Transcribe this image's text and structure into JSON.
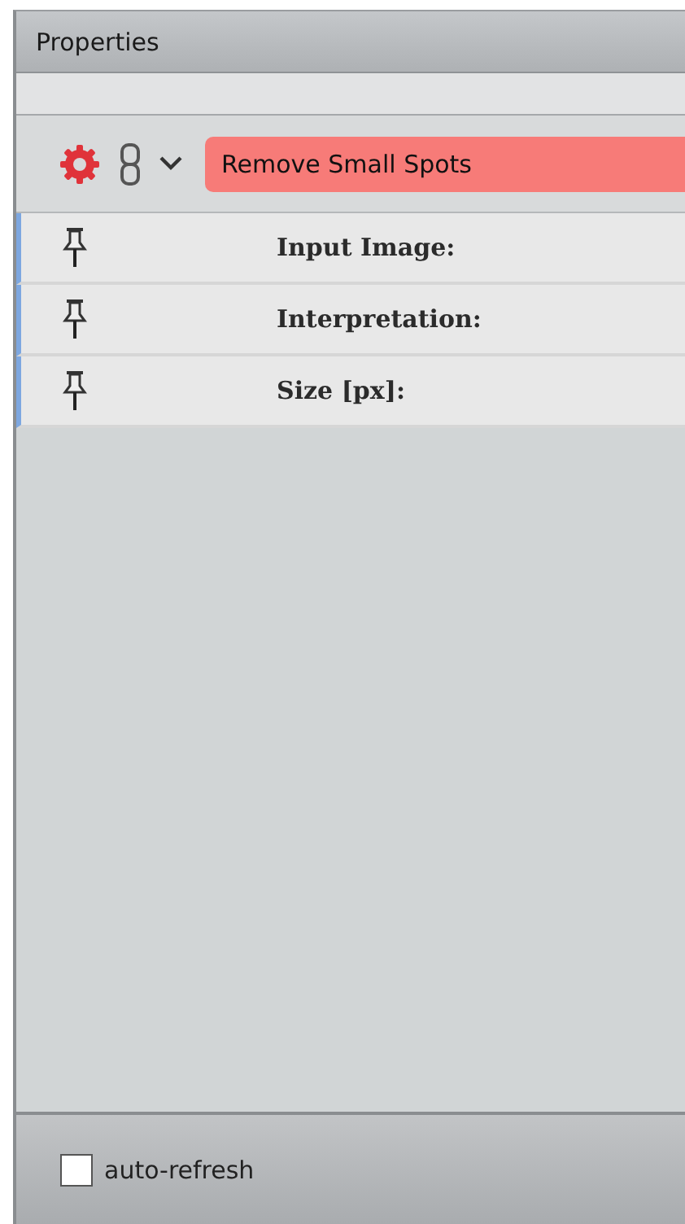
{
  "panel": {
    "title": "Properties"
  },
  "operator": {
    "name": "Remove Small Spots",
    "invalid": true
  },
  "parameters": [
    {
      "label": "Input Image:"
    },
    {
      "label": "Interpretation:"
    },
    {
      "label": "Size [px]:"
    }
  ],
  "footer": {
    "auto_refresh": {
      "label": "auto-refresh",
      "checked": false
    }
  }
}
